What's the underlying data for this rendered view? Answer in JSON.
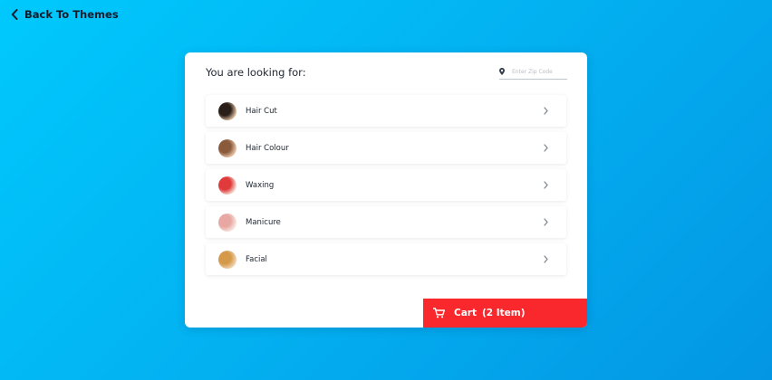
{
  "nav": {
    "back_label": "Back To Themes",
    "back_icon": "chevron-left-icon"
  },
  "card": {
    "title": "You are looking for:",
    "zip": {
      "icon": "map-pin-icon",
      "placeholder": "Enter Zip Code",
      "value": ""
    }
  },
  "services": [
    {
      "label": "Hair Cut",
      "thumb": "hair-cut-thumbnail",
      "colors": [
        "#2a1e18",
        "#d7b89b"
      ]
    },
    {
      "label": "Hair Colour",
      "thumb": "hair-colour-thumbnail",
      "colors": [
        "#8a5a3b",
        "#e6c2a6"
      ]
    },
    {
      "label": "Waxing",
      "thumb": "waxing-thumbnail",
      "colors": [
        "#e03a3a",
        "#f2d8cf"
      ]
    },
    {
      "label": "Manicure",
      "thumb": "manicure-thumbnail",
      "colors": [
        "#e8a7a2",
        "#f6e4de"
      ]
    },
    {
      "label": "Facial",
      "thumb": "facial-thumbnail",
      "colors": [
        "#d49a4a",
        "#f0d2ae"
      ]
    }
  ],
  "cart": {
    "icon": "shopping-cart-icon",
    "label": "Cart",
    "count_text": "(2 Item)"
  },
  "colors": {
    "background_start": "#00c9fd",
    "background_end": "#0396e3",
    "cart_red": "#f8282c"
  }
}
